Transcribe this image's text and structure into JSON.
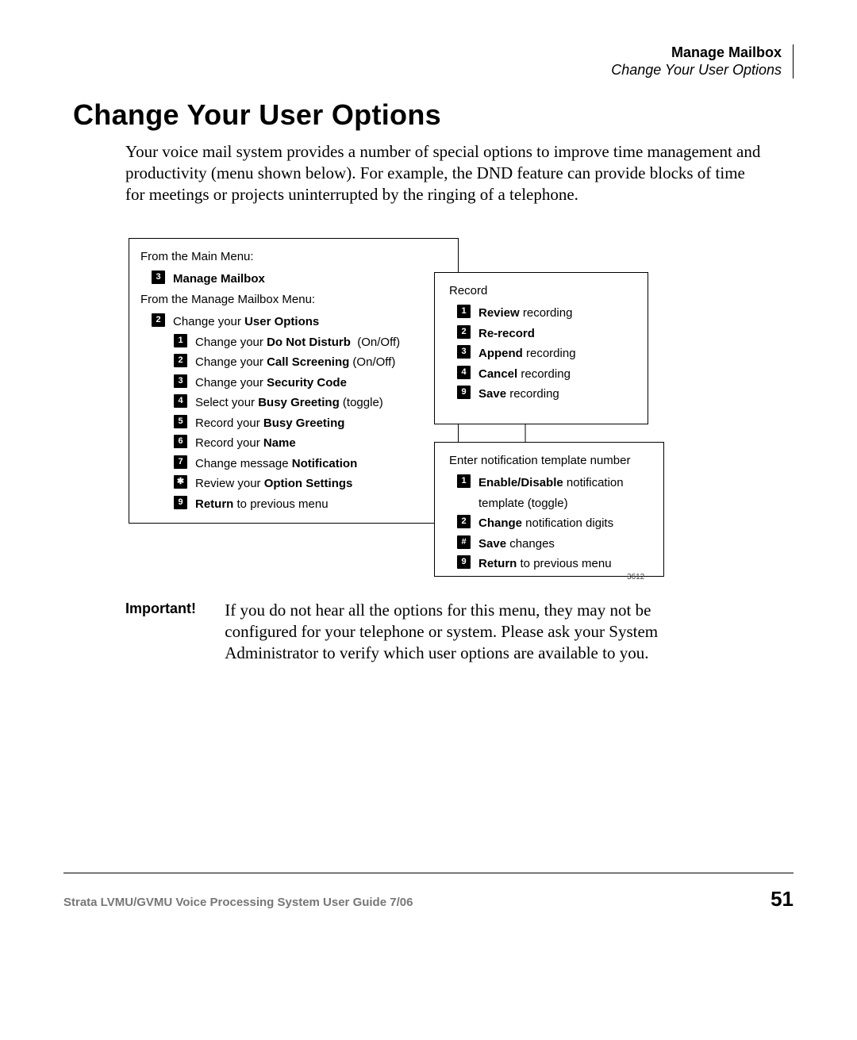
{
  "header": {
    "primary": "Manage Mailbox",
    "secondary": "Change Your User Options"
  },
  "title": "Change Your User Options",
  "intro": "Your voice mail system provides a number of special options to improve time management and productivity (menu shown below). For example, the DND feature can provide blocks of time for meetings or projects uninterrupted by the ringing of a telephone.",
  "diagram": {
    "id": "3612",
    "main": {
      "line1": "From the Main Menu:",
      "k3": "3",
      "k3_label": "<b>Manage Mailbox</b>",
      "line2": "From the Manage Mailbox Menu:",
      "k2": "2",
      "k2_label": "Change your <b>User Options</b>",
      "sub": [
        {
          "key": "1",
          "label": "Change your <b>Do Not Disturb</b> &nbsp;(On/Off)"
        },
        {
          "key": "2",
          "label": "Change your <b>Call Screening</b> (On/Off)"
        },
        {
          "key": "3",
          "label": "Change your <b>Security Code</b>"
        },
        {
          "key": "4",
          "label": "Select your <b>Busy Greeting</b> (toggle)"
        },
        {
          "key": "5",
          "label": "Record your <b>Busy Greeting</b>"
        },
        {
          "key": "6",
          "label": "Record your <b>Name</b>"
        },
        {
          "key": "7",
          "label": "Change message <b>Notification</b>"
        },
        {
          "key": "✱",
          "label": "Review your <b>Option Settings</b>"
        },
        {
          "key": "9",
          "label": "<b>Return</b> to previous menu"
        }
      ]
    },
    "record": {
      "title": "Record",
      "items": [
        {
          "key": "1",
          "label": "<b>Review</b> recording"
        },
        {
          "key": "2",
          "label": "<b>Re-record</b>"
        },
        {
          "key": "3",
          "label": "<b>Append</b> recording"
        },
        {
          "key": "4",
          "label": "<b>Cancel</b> recording"
        },
        {
          "key": "9",
          "label": "<b>Save</b> recording"
        }
      ]
    },
    "notify": {
      "title": "Enter notification template number",
      "items": [
        {
          "key": "1",
          "label": "<b>Enable/Disable</b> notification template (toggle)"
        },
        {
          "key": "2",
          "label": "<b>Change</b> notification digits"
        },
        {
          "key": "#",
          "label": "<b>Save</b> changes"
        },
        {
          "key": "9",
          "label": "<b>Return</b> to previous menu"
        }
      ]
    }
  },
  "note": {
    "label": "Important!",
    "body": "If you do not hear all the options for this menu, they may not be configured for your telephone or system. Please ask your System Administrator to verify which user options are available to you."
  },
  "footer": {
    "left": "Strata LVMU/GVMU Voice Processing System User Guide   7/06",
    "page": "51"
  }
}
